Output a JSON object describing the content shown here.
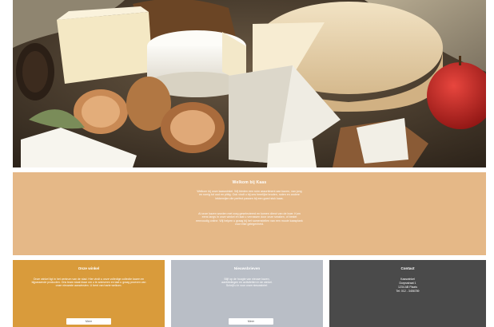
{
  "hero": {
    "icon": "cheese-photo"
  },
  "intro": {
    "title": "Welkom bij Kaas",
    "paragraph1": "Welkom bij onze kaaswinkel. Wij bieden een ruim assortiment aan kazen, van jong en romig tot oud en pittig. Ook vindt u bij ons heerlijke broden, noten en andere lekkernijen die perfect passen bij een goed stuk kaas.",
    "paragraph2": "Al onze kazen worden met zorg geselecteerd en komen direct van de boer. Kom eens langs in onze winkel en laat u verrassen door onze smaken, of bestel eenvoudig online. Wij helpen u graag bij het samenstellen van een mooie kaasplank voor elke gelegenheid."
  },
  "columns": [
    {
      "title": "Onze winkel",
      "text": "Onze winkel ligt in het centrum van de stad. Hier vindt u onze volledige collectie kazen en bijpassende producten. Ons team staat klaar om u te adviseren en laat u graag proeven van onze nieuwste aanwinsten. U bent van harte welkom.",
      "button": "Meer"
    },
    {
      "title": "Nieuwsbrieven",
      "text": "Blijf op de hoogte van nieuwe kazen, aanbiedingen en activiteiten in de winkel. Schrijf u in voor onze nieuwsbrief.",
      "button": "Meer"
    },
    {
      "title": "Contact",
      "lines": [
        "Kaaswinkel",
        "Dorpsstraat 1",
        "1234 AB Plaats",
        "Tel: 012 - 3456789"
      ]
    }
  ]
}
